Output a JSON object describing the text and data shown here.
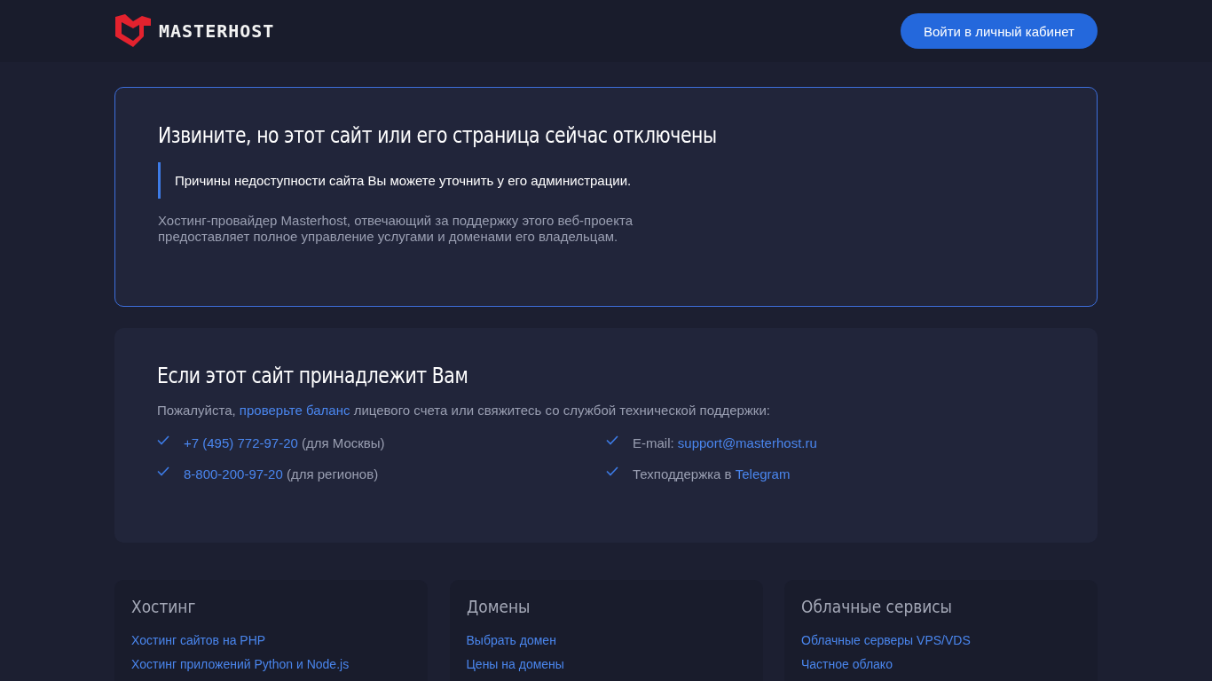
{
  "header": {
    "logo": "MASTERHOST",
    "login_button": "Войти в личный кабинет"
  },
  "notice": {
    "title": "Извините, но этот сайт или его страница сейчас отключены",
    "quote": "Причины недоступности сайта Вы можете уточнить у его администрации.",
    "text_lines": [
      "Хостинг-провайдер Masterhost, отвечающий за поддержку этого веб-проекта",
      "предоставляет полное управление услугами и доменами его владельцам."
    ]
  },
  "owner": {
    "title": "Если этот сайт принадлежит Вам",
    "intro": [
      {
        "kind": "text",
        "text": "Пожалуйста, "
      },
      {
        "kind": "link",
        "text": "проверьте баланс"
      },
      {
        "kind": "text",
        "text": " лицевого счета или свяжитесь со службой технической поддержки:"
      }
    ],
    "contacts": [
      [
        {
          "kind": "link",
          "text": "+7 (495) 772-97-20"
        },
        {
          "kind": "text",
          "text": " (для Москвы)"
        }
      ],
      [
        {
          "kind": "text",
          "text": "E-mail: "
        },
        {
          "kind": "link",
          "text": "support@masterhost.ru"
        }
      ],
      [
        {
          "kind": "link",
          "text": "8-800-200-97-20"
        },
        {
          "kind": "text",
          "text": " (для регионов)"
        }
      ],
      [
        {
          "kind": "text",
          "text": "Техподдержка в "
        },
        {
          "kind": "link",
          "text": "Telegram"
        }
      ]
    ]
  },
  "footer": [
    {
      "title": "Хостинг",
      "links": [
        "Хостинг сайтов на PHP",
        "Хостинг приложений Python и Node.js"
      ]
    },
    {
      "title": "Домены",
      "links": [
        "Выбрать домен",
        "Цены на домены"
      ]
    },
    {
      "title": "Облачные сервисы",
      "links": [
        "Облачные серверы VPS/VDS",
        "Частное облако"
      ]
    }
  ]
}
